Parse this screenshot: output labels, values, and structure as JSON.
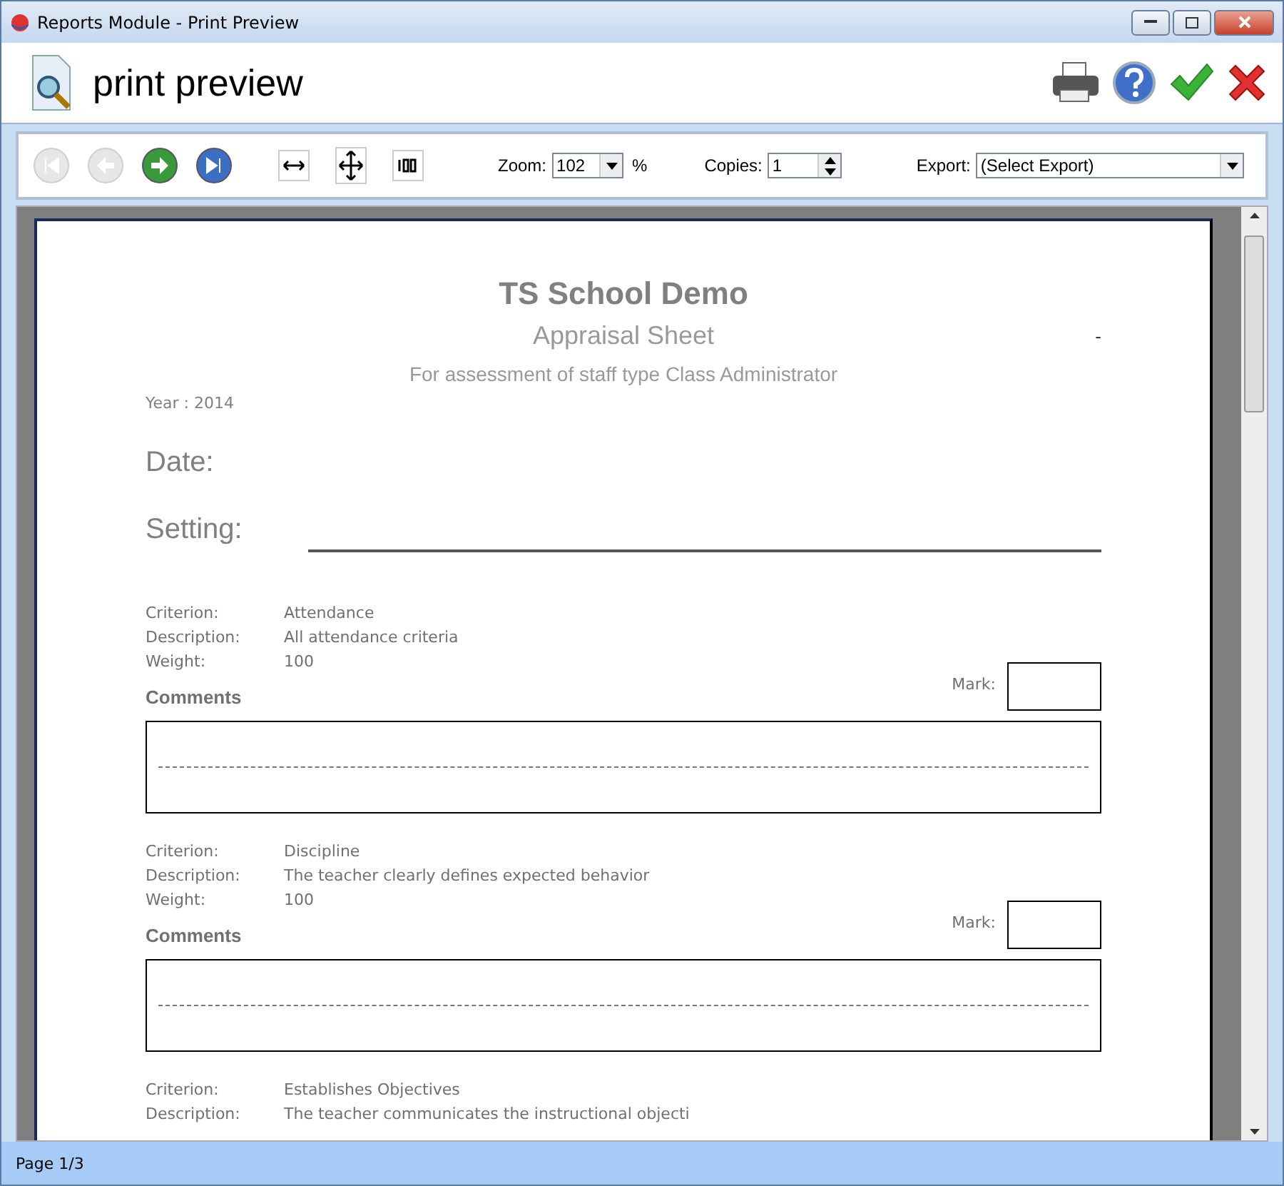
{
  "window": {
    "title": "Reports Module - Print Preview"
  },
  "header": {
    "title": "print preview"
  },
  "toolbar": {
    "nav_buttons": [
      {
        "kind": "first",
        "disabled": true
      },
      {
        "kind": "prev",
        "disabled": true
      },
      {
        "kind": "next",
        "disabled": false
      },
      {
        "kind": "last",
        "disabled": false
      }
    ],
    "zoom": {
      "label": "Zoom:",
      "value": "102",
      "unit": "%"
    },
    "copies": {
      "label": "Copies:",
      "value": "1"
    },
    "export": {
      "label": "Export:",
      "value": "(Select Export)"
    }
  },
  "report": {
    "school": "TS School Demo",
    "title": "Appraisal Sheet",
    "dash": "-",
    "subtitle": "For assessment of staff type Class Administrator",
    "year": "Year : 2014",
    "date_label": "Date:",
    "setting_label": "Setting:",
    "criteria": [
      {
        "fields": [
          {
            "label": "Criterion:",
            "value": "Attendance"
          },
          {
            "label": "Description:",
            "value": "All attendance criteria"
          },
          {
            "label": "Weight:",
            "value": "100"
          }
        ],
        "comments_label": "Comments",
        "mark_label": "Mark:"
      },
      {
        "fields": [
          {
            "label": "Criterion:",
            "value": "Discipline"
          },
          {
            "label": "Description:",
            "value": "The teacher clearly defines expected behavior"
          },
          {
            "label": "Weight:",
            "value": "100"
          }
        ],
        "comments_label": "Comments",
        "mark_label": "Mark:"
      },
      {
        "fields": [
          {
            "label": "Criterion:",
            "value": "Establishes Objectives"
          },
          {
            "label": "Description:",
            "value": "The teacher communicates the instructional objecti"
          }
        ]
      }
    ]
  },
  "status_bar": {
    "text": "Page 1/3"
  }
}
